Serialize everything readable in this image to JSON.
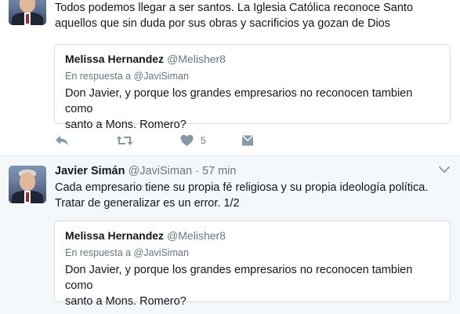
{
  "tweets": [
    {
      "text": "Todos podemos llegar a ser santos. La Iglesia Católica reconoce Santo\naquellos que sin duda por sus obras y sacrificios ya gozan de Dios",
      "quote": {
        "name": "Melissa Hernandez",
        "handle": "@Melisher8",
        "reply_to": "En respuesta a @JaviSiman",
        "text": "Don Javier, y porque los grandes empresarios no reconocen tambien como\nsanto a Mons. Romero?"
      },
      "actions": {
        "like_count": "5"
      }
    },
    {
      "name": "Javier Simán",
      "handle": "@JaviSiman",
      "separator": "·",
      "time": "57 min",
      "text": "Cada empresario tiene su propia fé religiosa y su propia ideología política.\nTratar de generalizar es un error.    1/2",
      "quote": {
        "name": "Melissa Hernandez",
        "handle": "@Melisher8",
        "reply_to": "En respuesta a @JaviSiman",
        "text": "Don Javier, y porque los grandes empresarios no reconocen tambien como\nsanto a Mons. Romero?"
      }
    }
  ],
  "icons": {
    "reply": "reply-icon",
    "retweet": "retweet-icon",
    "like": "heart-icon",
    "dm": "envelope-icon",
    "caret": "chevron-down-icon"
  },
  "colors": {
    "text": "#14171a",
    "secondary": "#657786",
    "icon": "#8899a6",
    "hover_bg": "#f5f8fa",
    "border": "#e6ecf0"
  }
}
